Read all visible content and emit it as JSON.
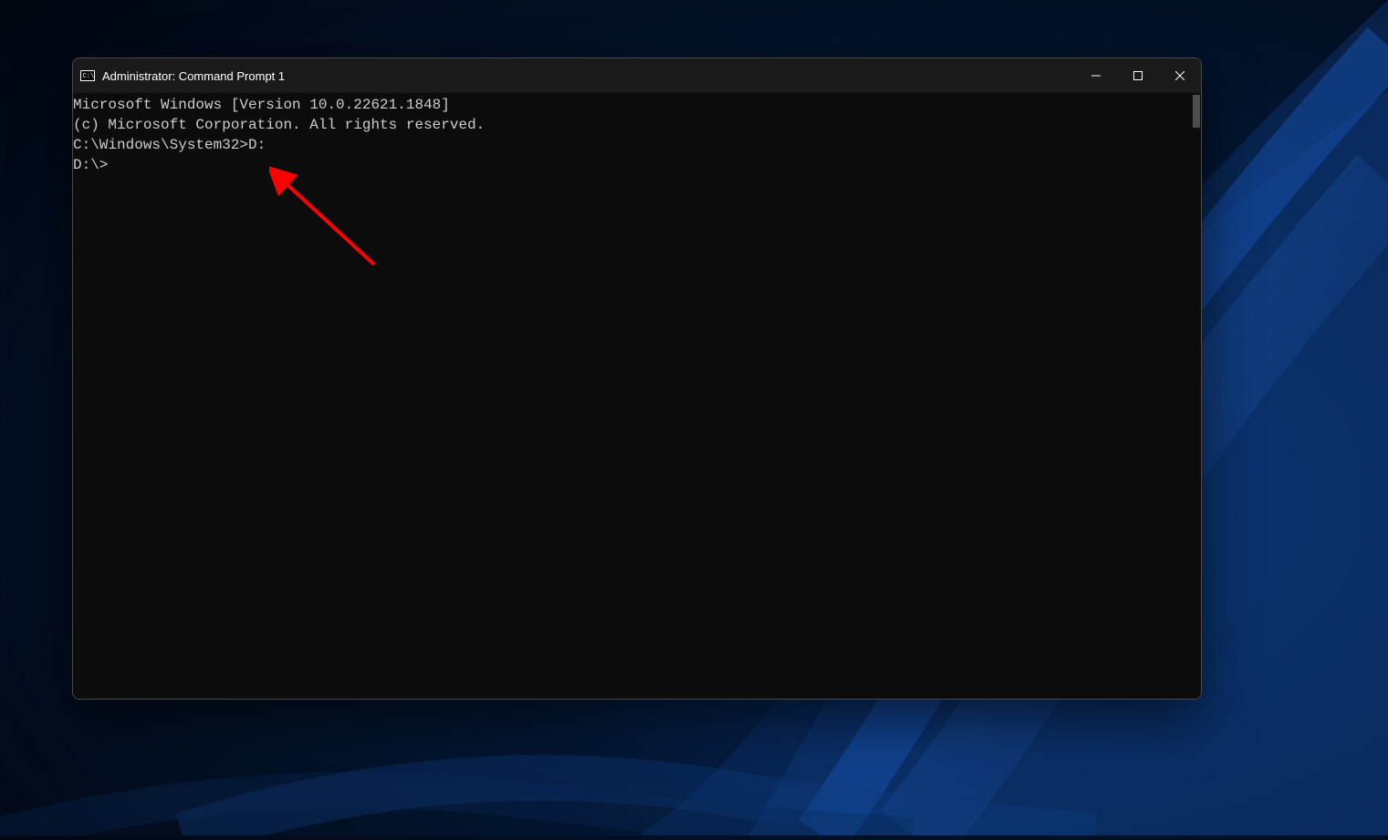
{
  "window": {
    "title": "Administrator: Command Prompt 1"
  },
  "terminal": {
    "line1": "Microsoft Windows [Version 10.0.22621.1848]",
    "line2": "(c) Microsoft Corporation. All rights reserved.",
    "line3": "",
    "line4": "C:\\Windows\\System32>D:",
    "line5": "",
    "line6": "D:\\>"
  }
}
